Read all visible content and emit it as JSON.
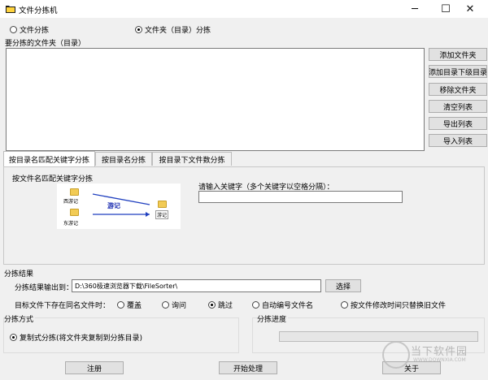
{
  "window": {
    "title": "文件分拣机",
    "minimize_glyph": "─",
    "maximize_glyph": "☐",
    "close_glyph": "✕"
  },
  "mode": {
    "file_sort": "文件分拣",
    "folder_sort": "文件夹（目录）分拣",
    "selected": "folder_sort"
  },
  "folders": {
    "label": "要分拣的文件夹（目录）",
    "items": []
  },
  "side_buttons": {
    "add_folder": "添加文件夹",
    "add_subfolders": "添加目录下级目录",
    "remove_folder": "移除文件夹",
    "clear_list": "清空列表",
    "export_list": "导出列表",
    "import_list": "导入列表"
  },
  "tabs": [
    {
      "label": "按目录名匹配关键字分拣",
      "active": true
    },
    {
      "label": "按目录名分拣",
      "active": false
    },
    {
      "label": "按目录下文件数分拣",
      "active": false
    }
  ],
  "tab_panel": {
    "heading": "按文件名匹配关键字分拣",
    "keyword_label": "请输入关键字（多个关键字以空格分隔）：",
    "keyword_value": "",
    "illustration": {
      "file1": "西游记",
      "file2": "东游记",
      "keyword": "游记",
      "target": "游记"
    }
  },
  "result": {
    "section_label": "分拣结果",
    "output_label": "分拣结果输出到：",
    "output_path": "D:\\360极速浏览器下载\\FileSorter\\",
    "choose_button": "选择",
    "conflict_label": "目标文件下存在同名文件时：",
    "options": [
      "覆盖",
      "询问",
      "跳过",
      "自动编号文件名",
      "按文件修改时间只替换旧文件"
    ],
    "selected_option": "跳过"
  },
  "method": {
    "section_label": "分拣方式",
    "option": "复制式分拣(将文件夹复制到分拣目录)"
  },
  "progress": {
    "section_label": "分拣进度",
    "value": 0
  },
  "bottom_buttons": {
    "register": "注册",
    "start": "开始处理",
    "about": "关于"
  },
  "watermark": {
    "text": "当下软件园",
    "url": "WWW.DOWNXIA.COM"
  },
  "colors": {
    "arrow_blue": "#1f3fbf",
    "folder_yellow": "#f2cb55",
    "keyword_blue": "#1a2bb0"
  }
}
